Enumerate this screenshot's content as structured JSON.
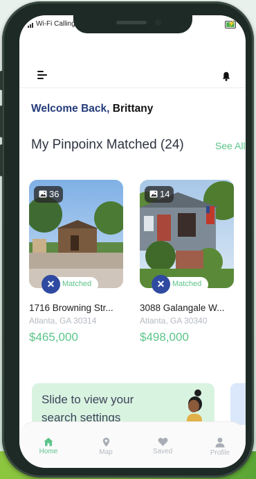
{
  "status_bar": {
    "carrier": "Wi-Fi Calling"
  },
  "greeting": {
    "prefix": "Welcome Back,",
    "name": "Brittany"
  },
  "section": {
    "title": "My Pinpoinx Matched (24)",
    "see_all": "See All"
  },
  "listings": [
    {
      "photo_count": "36",
      "matched_label": "Matched",
      "address": "1716 Browning Str...",
      "city": "Atlanta, GA 30314",
      "price": "$465,000"
    },
    {
      "photo_count": "14",
      "matched_label": "Matched",
      "address": "3088 Galangale W...",
      "city": "Atlanta, GA 30340",
      "price": "$498,000"
    }
  ],
  "promo": {
    "text": "Slide to view your search settings"
  },
  "tabs": [
    {
      "label": "Home",
      "icon": "home-icon",
      "active": true
    },
    {
      "label": "Map",
      "icon": "map-pin-icon",
      "active": false
    },
    {
      "label": "Saved",
      "icon": "heart-icon",
      "active": false
    },
    {
      "label": "Profile",
      "icon": "user-icon",
      "active": false
    }
  ],
  "colors": {
    "accent_green": "#5cc48a",
    "brand_blue": "#243b7a",
    "logo_blue": "#2f4aa0"
  }
}
